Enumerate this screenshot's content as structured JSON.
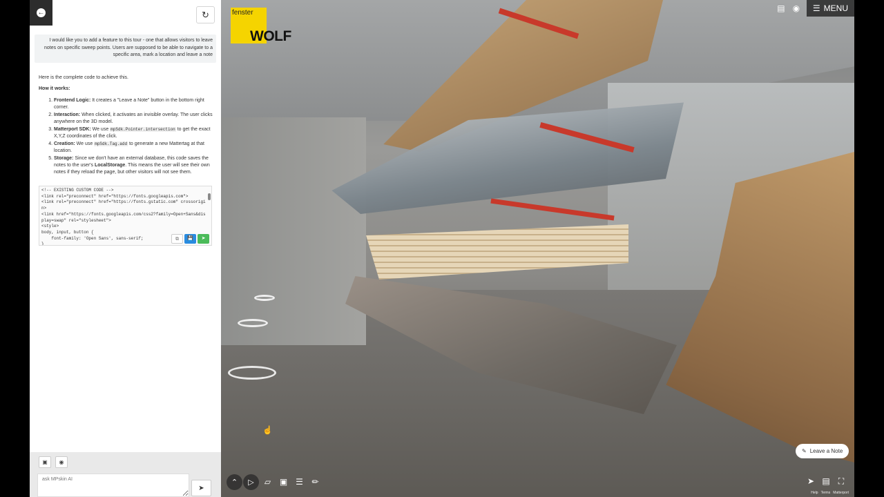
{
  "panel": {
    "back_icon": "arrow-left-icon",
    "refresh_icon": "refresh-icon",
    "user_message": "I would like you to add a feature to this tour - one that allows visitors to leave notes on specific sweep points. Users are supposed to be able to navigate to a specific area, mark a location and leave a note",
    "reply": {
      "intro": "Here is the complete code to achieve this.",
      "how_heading": "How it works:",
      "steps": [
        {
          "title": "Frontend Logic:",
          "text": " It creates a \"Leave a Note\" button in the bottom right corner."
        },
        {
          "title": "Interaction:",
          "text": " When clicked, it activates an invisible overlay. The user clicks anywhere on the 3D model."
        },
        {
          "title": "Matterport SDK:",
          "pre": " We use ",
          "code": "mpSdk.Pointer.intersection",
          "post": " to get the exact X,Y,Z coordinates of the click."
        },
        {
          "title": "Creation:",
          "pre": " We use ",
          "code": "mpSdk.Tag.add",
          "post": " to generate a new Mattertag at that location."
        },
        {
          "title": "Storage:",
          "pre": " Since we don't have an external database, this code saves the notes to the user's ",
          "bold": "LocalStorage",
          "post": ". This means the user will see their own notes if they reload the page, but other visitors will not see them."
        }
      ]
    },
    "code": "<!-- EXISTING CUSTOM CODE -->\n<link rel=\"preconnect\" href=\"https://fonts.googleapis.com\">\n<link rel=\"preconnect\" href=\"https://fonts.gstatic.com\" crossorigin>\n<link href=\"https://fonts.googleapis.com/css2?family=Open+Sans&display=swap\" rel=\"stylesheet\">\n<style>\nbody, input, button {\n    font-family: 'Open Sans', sans-serif;\n}",
    "composer": {
      "placeholder": "ask MPskin AI",
      "image_icon": "image-icon",
      "screenshot_icon": "screenshot-icon",
      "send_icon": "send-icon"
    }
  },
  "viewer": {
    "brand_small": "fenster",
    "brand_big": "WOLF",
    "brand_color": "#f5d400",
    "menu_label": "MENU",
    "leave_note_label": "Leave a Note",
    "footer": [
      "Help",
      "Terms",
      "Matterport"
    ]
  }
}
